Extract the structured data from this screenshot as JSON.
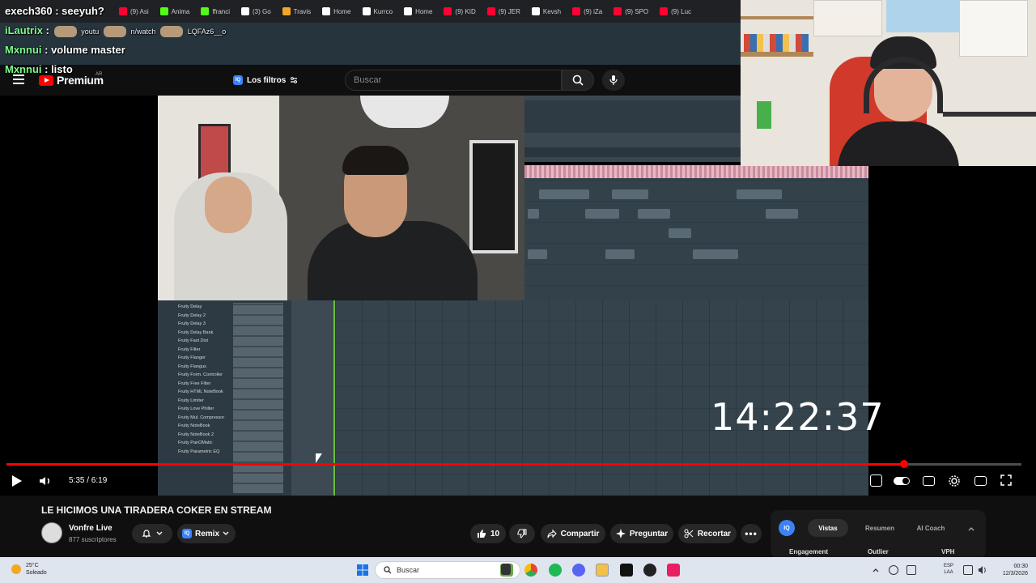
{
  "bookmarks": [
    {
      "label": "(9) Asi",
      "color": "#ff0033"
    },
    {
      "label": "Anima",
      "color": "#53fc18"
    },
    {
      "label": "ffranci",
      "color": "#53fc18"
    },
    {
      "label": "(3) Go",
      "color": "#ffffff"
    },
    {
      "label": "Travis",
      "color": "#f5a623"
    },
    {
      "label": "Home",
      "color": "#ffffff"
    },
    {
      "label": "Kurrco",
      "color": "#ffffff"
    },
    {
      "label": "Home",
      "color": "#ffffff"
    },
    {
      "label": "(9) KID",
      "color": "#ff0033"
    },
    {
      "label": "(9) JER",
      "color": "#ff0033"
    },
    {
      "label": "Kevsh",
      "color": "#ffffff"
    },
    {
      "label": "(9) iZa",
      "color": "#ff0033"
    },
    {
      "label": "(9) SPO",
      "color": "#ff0033"
    },
    {
      "label": "(9) Luc",
      "color": "#ff0033"
    }
  ],
  "chat": [
    {
      "user": "exech360",
      "user_color": "#ffffff",
      "message": ": seeyuh?"
    },
    {
      "user": "iLautrix",
      "user_color": "#7cfc8a",
      "message": ":",
      "url_parts": [
        "youtu",
        "n/watch",
        "LQFAz6__o"
      ]
    },
    {
      "user": "Mxnnui",
      "user_color": "#7cfc8a",
      "message": ": volume master"
    },
    {
      "user": "Mxnnui",
      "user_color": "#7cfc8a",
      "message": ": listo"
    }
  ],
  "youtube": {
    "brand": "Premium",
    "country": "AR",
    "filter_label": "Los filtros",
    "search_placeholder": "Buscar",
    "iq_badge": "IQ"
  },
  "fl_plugins": [
    "Fruity Delay",
    "Fruity Delay 2",
    "Fruity Delay 3",
    "Fruity Delay Bank",
    "Fruity Fast Dist",
    "Fruity Filter",
    "Fruity Flanger",
    "Fruity Flangus",
    "Fruity Form. Controller",
    "Fruity Free Filter",
    "Fruity HTML NoteBook",
    "Fruity Limiter",
    "Fruity Love Philter",
    "Fruity Mul. Compressor",
    "Fruity NoteBook",
    "Fruity NoteBook 2",
    "Fruity PanOMatic",
    "Fruity Parametric EQ"
  ],
  "video": {
    "timer": "14:22:37",
    "time_display": "5:35 / 6:19",
    "progress": 0.884
  },
  "meta": {
    "title": "LE HICIMOS UNA TIRADERA COKER EN STREAM",
    "channel": "Vonfre Live",
    "subscribers": "877 suscriptores",
    "remix": "Remix",
    "likes": "10",
    "share": "Compartir",
    "ask": "Preguntar",
    "clip": "Recortar"
  },
  "iq_panel": {
    "badge": "IQ",
    "tabs": [
      "Vistas",
      "Resumen",
      "AI Coach"
    ],
    "columns": [
      "Engagement",
      "Outlier",
      "VPH"
    ]
  },
  "taskbar": {
    "temperature": "25°C",
    "weather": "Soleado",
    "search": "Buscar",
    "lang1": "ESP",
    "lang2": "LAA",
    "time": "00:30",
    "date": "12/3/2026"
  }
}
